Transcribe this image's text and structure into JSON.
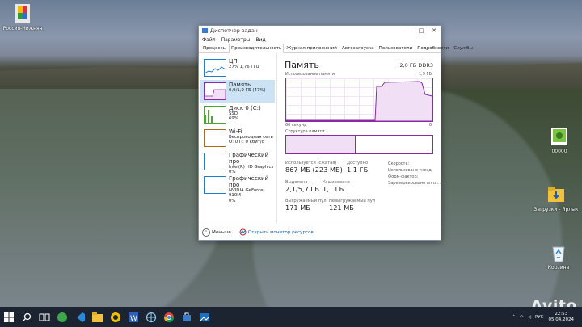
{
  "desktop": {
    "icons": [
      {
        "label": "Россия-Нижняя",
        "icon": "app-tile-icon"
      },
      {
        "label": "00000",
        "icon": "image-file-icon"
      },
      {
        "label": "Загрузки - Ярлык",
        "icon": "folder-download-icon"
      },
      {
        "label": "Корзина",
        "icon": "recycle-bin-icon"
      }
    ]
  },
  "window": {
    "title": "Диспетчер задач",
    "menu": [
      "Файл",
      "Параметры",
      "Вид"
    ],
    "tabs": [
      "Процессы",
      "Производительность",
      "Журнал приложений",
      "Автозагрузка",
      "Пользователи",
      "Подробности",
      "Службы"
    ],
    "active_tab": "Производительность"
  },
  "sidebar": [
    {
      "title": "ЦП",
      "line1": "27%  1,76 ГГц",
      "line2": "",
      "color": "#1a7fd1"
    },
    {
      "title": "Память",
      "line1": "0,9/1,9 ГБ (47%)",
      "line2": "",
      "color": "#8b29a8"
    },
    {
      "title": "Диск 0 (C:)",
      "line1": "SSD",
      "line2": "69%",
      "color": "#4aa832"
    },
    {
      "title": "Wi-Fi",
      "line1": "Беспроводная сеть",
      "line2": "О: 0  П: 0 кбит/с",
      "color": "#a86820"
    },
    {
      "title": "Графический про",
      "line1": "Intel(R) HD Graphics",
      "line2": "0%",
      "color": "#1a7fd1"
    },
    {
      "title": "Графический про",
      "line1": "NVIDIA GeForce 910M",
      "line2": "0%",
      "color": "#1a7fd1"
    }
  ],
  "memory": {
    "title": "Память",
    "capacity": "2,0 ГБ DDR3",
    "usage_label": "Использование памяти",
    "usage_max": "1,9 ГБ",
    "time_label": "60 секунд",
    "zero_label": "0",
    "structure_label": "Структура памяти",
    "used_fraction": 0.47,
    "stats": [
      {
        "label": "Используется (сжатая)",
        "value": "867 МБ (223 МБ)"
      },
      {
        "label": "Доступно",
        "value": "1,1 ГБ"
      },
      {
        "label": "Выделено",
        "value": "2,1/5,7 ГБ"
      },
      {
        "label": "Кэшировано",
        "value": "1,1 ГБ"
      },
      {
        "label": "Выгружаемый пул",
        "value": "171 МБ"
      },
      {
        "label": "Невыгружаемый пул",
        "value": "121 МБ"
      }
    ],
    "info": [
      "Скорость:",
      "Использовано гнезд:",
      "Форм-фактор:",
      "Зарезервировано аппа..."
    ]
  },
  "footer": {
    "less": "Меньше",
    "monitor": "Открыть монитор ресурсов"
  },
  "taskbar": {
    "lang": "РУС",
    "time": "22:53",
    "date": "05.04.2024",
    "icons": [
      "start-icon",
      "search-icon",
      "task-view-icon",
      "app-green-icon",
      "vscode-icon",
      "folder-icon",
      "yellow-app-icon",
      "word-icon",
      "network-icon",
      "chrome-icon",
      "store-icon",
      "photos-icon"
    ]
  },
  "watermark": "Avito"
}
